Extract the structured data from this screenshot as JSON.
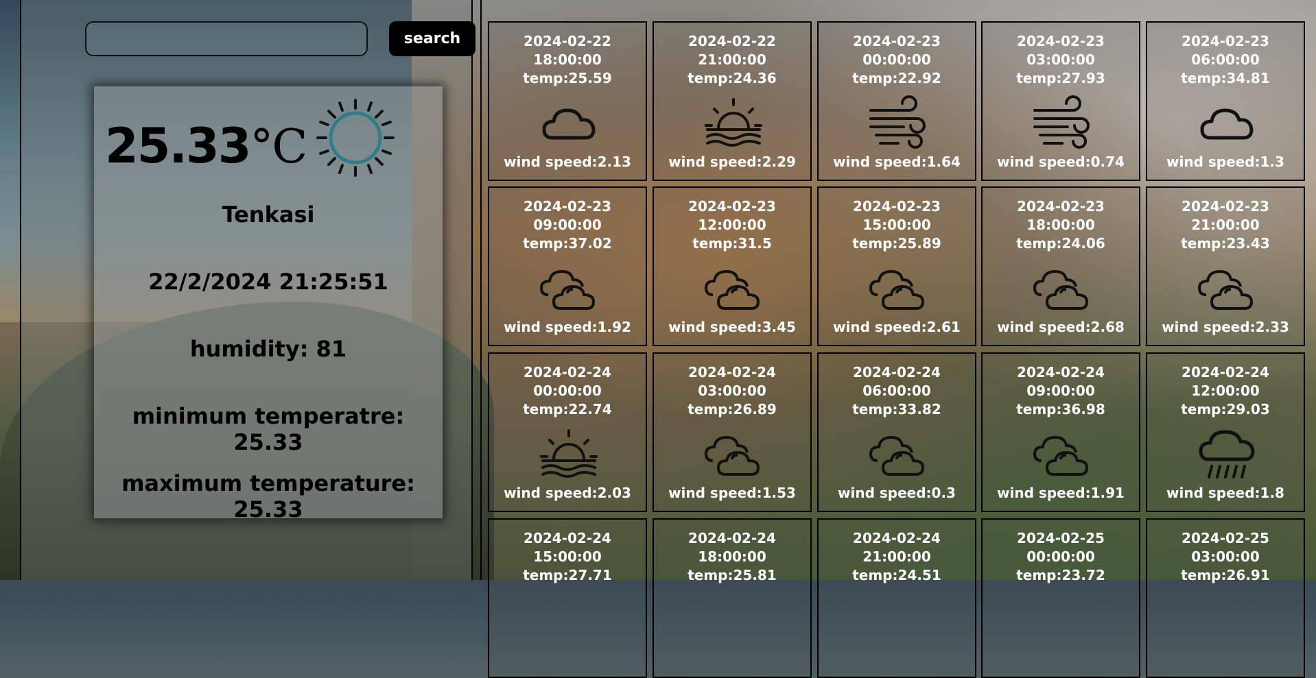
{
  "search": {
    "placeholder": "",
    "value": "",
    "button_label": "search"
  },
  "current": {
    "temperature": "25.33",
    "unit": "°C",
    "icon": "sun-icon",
    "icon_color": "#2e7d8a",
    "city": "Tenkasi",
    "datetime": "22/2/2024 21:25:51",
    "humidity": "humidity: 81",
    "min_temp": "minimum temperatre: 25.33",
    "max_temp": "maximum temperature: 25.33"
  },
  "forecast": [
    {
      "date": "2024-02-22",
      "time": "18:00:00",
      "temp": "temp:25.59",
      "icon": "cloud-icon",
      "wind": "wind speed:2.13"
    },
    {
      "date": "2024-02-22",
      "time": "21:00:00",
      "temp": "temp:24.36",
      "icon": "sunset-icon",
      "wind": "wind speed:2.29"
    },
    {
      "date": "2024-02-23",
      "time": "00:00:00",
      "temp": "temp:22.92",
      "icon": "wind-icon",
      "wind": "wind speed:1.64"
    },
    {
      "date": "2024-02-23",
      "time": "03:00:00",
      "temp": "temp:27.93",
      "icon": "wind-icon",
      "wind": "wind speed:0.74"
    },
    {
      "date": "2024-02-23",
      "time": "06:00:00",
      "temp": "temp:34.81",
      "icon": "cloud-icon",
      "wind": "wind speed:1.3"
    },
    {
      "date": "2024-02-23",
      "time": "09:00:00",
      "temp": "temp:37.02",
      "icon": "clouds-icon",
      "wind": "wind speed:1.92"
    },
    {
      "date": "2024-02-23",
      "time": "12:00:00",
      "temp": "temp:31.5",
      "icon": "clouds-icon",
      "wind": "wind speed:3.45"
    },
    {
      "date": "2024-02-23",
      "time": "15:00:00",
      "temp": "temp:25.89",
      "icon": "clouds-icon",
      "wind": "wind speed:2.61"
    },
    {
      "date": "2024-02-23",
      "time": "18:00:00",
      "temp": "temp:24.06",
      "icon": "clouds-icon",
      "wind": "wind speed:2.68"
    },
    {
      "date": "2024-02-23",
      "time": "21:00:00",
      "temp": "temp:23.43",
      "icon": "clouds-icon",
      "wind": "wind speed:2.33"
    },
    {
      "date": "2024-02-24",
      "time": "00:00:00",
      "temp": "temp:22.74",
      "icon": "sunset-icon",
      "wind": "wind speed:2.03"
    },
    {
      "date": "2024-02-24",
      "time": "03:00:00",
      "temp": "temp:26.89",
      "icon": "clouds-icon",
      "wind": "wind speed:1.53"
    },
    {
      "date": "2024-02-24",
      "time": "06:00:00",
      "temp": "temp:33.82",
      "icon": "clouds-icon",
      "wind": "wind speed:0.3"
    },
    {
      "date": "2024-02-24",
      "time": "09:00:00",
      "temp": "temp:36.98",
      "icon": "clouds-icon",
      "wind": "wind speed:1.91"
    },
    {
      "date": "2024-02-24",
      "time": "12:00:00",
      "temp": "temp:29.03",
      "icon": "rain-icon",
      "wind": "wind speed:1.8"
    },
    {
      "date": "2024-02-24",
      "time": "15:00:00",
      "temp": "temp:27.71",
      "icon": "",
      "wind": ""
    },
    {
      "date": "2024-02-24",
      "time": "18:00:00",
      "temp": "temp:25.81",
      "icon": "",
      "wind": ""
    },
    {
      "date": "2024-02-24",
      "time": "21:00:00",
      "temp": "temp:24.51",
      "icon": "",
      "wind": ""
    },
    {
      "date": "2024-02-25",
      "time": "00:00:00",
      "temp": "temp:23.72",
      "icon": "",
      "wind": ""
    },
    {
      "date": "2024-02-25",
      "time": "03:00:00",
      "temp": "temp:26.91",
      "icon": "",
      "wind": ""
    }
  ]
}
